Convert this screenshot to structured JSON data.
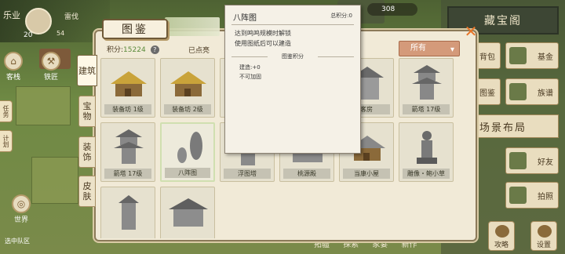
{
  "hud": {
    "side_title": "乐业",
    "player_name": "雷伐",
    "level": "20",
    "stat": "54",
    "coins": "308",
    "left_icons": [
      "客栈",
      "铁匠"
    ],
    "left_tabs": [
      "任务",
      "计划"
    ],
    "bottom_left": [
      "世界",
      "选中队区"
    ]
  },
  "right_panel": {
    "title": "藏宝阁",
    "buttons": [
      "背包",
      "基金",
      "图鉴",
      "族谱"
    ],
    "section": "场景布局",
    "buttons2": [
      "好友",
      "拍照"
    ],
    "bottom_buttons": [
      "攻略",
      "设置"
    ]
  },
  "bottom_nav": [
    "拓疆",
    "探索",
    "家宴",
    "新作"
  ],
  "dialog": {
    "title": "图鉴",
    "score_label": "积分:",
    "score_value": "15224",
    "built_label": "已点亮",
    "filter": "所有",
    "categories": [
      "建筑",
      "宝物",
      "装饰",
      "皮肤"
    ],
    "cards": [
      {
        "label": "装备坊 1级",
        "color": "#c9a33a"
      },
      {
        "label": "装备坊 2级",
        "color": "#c9a33a"
      },
      {
        "label": "",
        "color": "#888"
      },
      {
        "label": "",
        "color": "#888"
      },
      {
        "label": "客房",
        "color": "#888"
      },
      {
        "label": "箭塔 17级",
        "color": "#888"
      },
      {
        "label": "箭塔 17级",
        "color": "#888"
      },
      {
        "label": "八阵图",
        "color": "#888"
      },
      {
        "label": "浮图塔",
        "color": "#888"
      },
      {
        "label": "桃源殿",
        "color": "#888"
      },
      {
        "label": "当康小屋",
        "color": "#888"
      },
      {
        "label": "雕像・鲍小草",
        "color": "#888"
      },
      {
        "label": "",
        "color": "#888"
      },
      {
        "label": "",
        "color": "#888"
      }
    ]
  },
  "tooltip": {
    "title": "八阵图",
    "total_score": "总积分:0",
    "desc1": "达到鸣鸣规模时解锁",
    "desc2": "使用图纸后可以建造",
    "section": "图鉴积分",
    "build_score": "建造:+0",
    "unlock": "不可加固"
  }
}
